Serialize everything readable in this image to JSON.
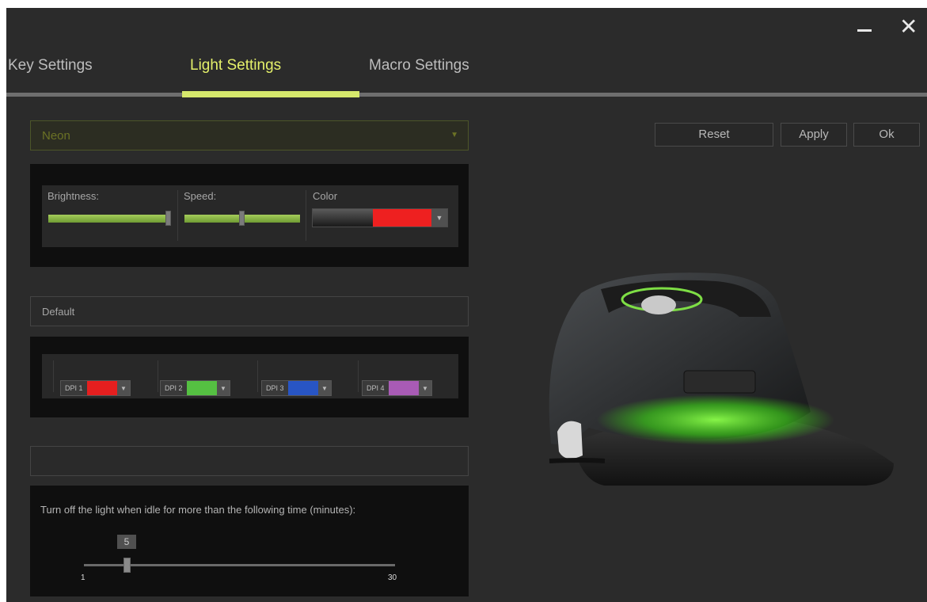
{
  "tabs": [
    "Key Settings",
    "Light Settings",
    "Macro Settings"
  ],
  "active_tab_index": 1,
  "effect": {
    "selected": "Neon"
  },
  "buttons": {
    "reset": "Reset",
    "apply": "Apply",
    "ok": "Ok"
  },
  "light": {
    "brightness_label": "Brightness:",
    "speed_label": "Speed:",
    "color_label": "Color",
    "brightness_level": 1.0,
    "speed_level": 0.5,
    "color_value": "#ee2020"
  },
  "profile": {
    "name": "Default"
  },
  "dpi": [
    {
      "label": "DPI 1",
      "color": "#e51f1f"
    },
    {
      "label": "DPI 2",
      "color": "#55c042"
    },
    {
      "label": "DPI 3",
      "color": "#2855c4"
    },
    {
      "label": "DPI 4",
      "color": "#a85bb5"
    }
  ],
  "idle": {
    "text": "Turn off the light when idle for more than the following time (minutes):",
    "value": "5",
    "min": "1",
    "max": "30"
  },
  "accent_color": "#d6e86c"
}
